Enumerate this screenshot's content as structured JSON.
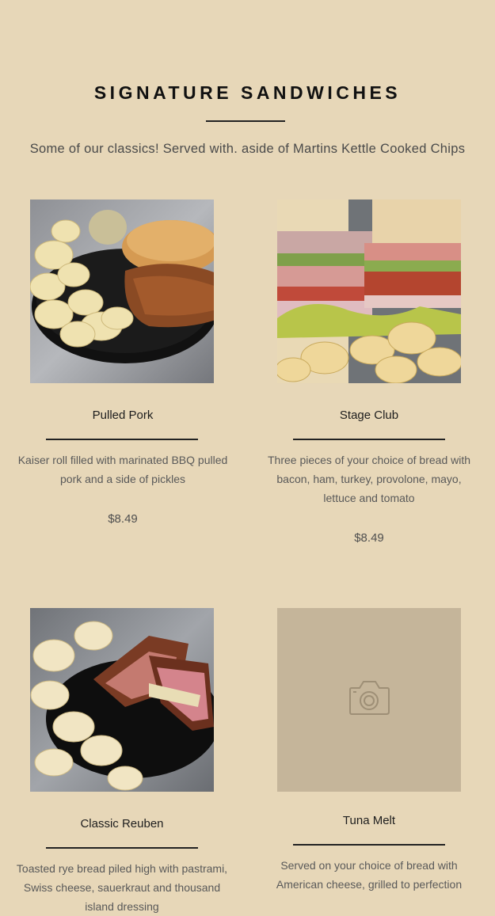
{
  "section": {
    "title": "SIGNATURE SANDWICHES",
    "subtitle": "Some of our classics! Served with. aside of Martins Kettle Cooked Chips"
  },
  "items": [
    {
      "name": "Pulled Pork",
      "description": "Kaiser roll filled with marinated BBQ pulled pork and a side of pickles",
      "price": "$8.49",
      "image": "pulled-pork-photo"
    },
    {
      "name": "Stage Club",
      "description": "Three pieces of your choice of bread with bacon, ham, turkey, provolone, mayo, lettuce and tomato",
      "price": "$8.49",
      "image": "stage-club-photo"
    },
    {
      "name": "Classic Reuben",
      "description": "Toasted rye bread piled high with pastrami, Swiss cheese, sauerkraut and thousand island dressing",
      "price": "",
      "image": "reuben-photo"
    },
    {
      "name": "Tuna Melt",
      "description": "Served on your choice of bread with American cheese, grilled to perfection",
      "price": "",
      "image": "camera-placeholder"
    }
  ],
  "colors": {
    "background": "#e7d7b8",
    "placeholder": "#c5b59a",
    "rule": "#222222"
  }
}
